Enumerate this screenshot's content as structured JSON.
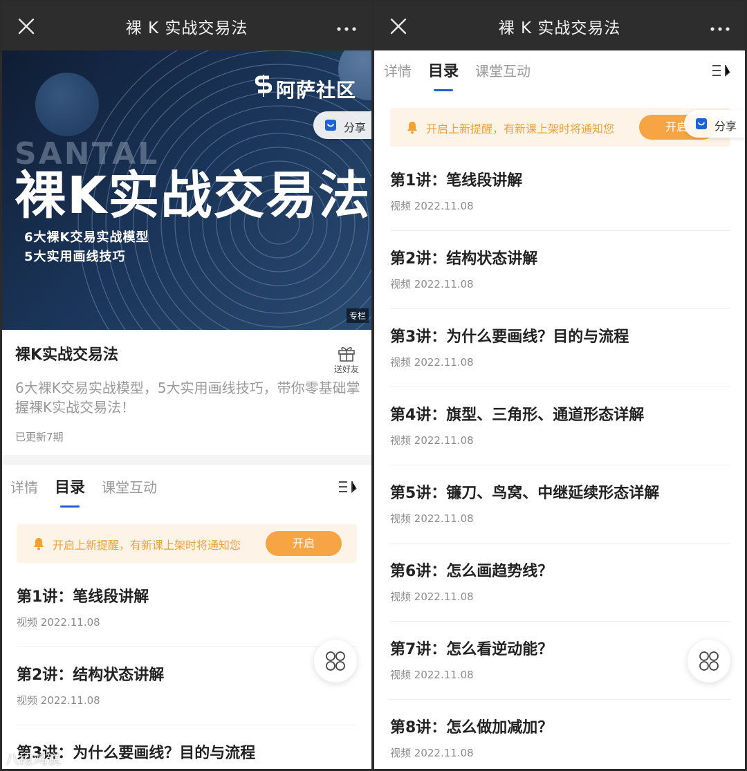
{
  "colors": {
    "accent": "#1b63d6",
    "notice_bg": "#fdf3e6",
    "notice_text": "#f0a23a",
    "on_button": "#f7a544",
    "navbar": "#2d2d2d"
  },
  "navbar": {
    "title": "裸 K 实战交易法",
    "close_icon": "close-icon",
    "more_icon": "more-icon"
  },
  "cover": {
    "brand": "阿萨社区",
    "watermark": "SANTAL",
    "title": "裸K实战交易法",
    "line1": "6大裸K交易实战模型",
    "line2": "5大实用画线技巧",
    "column_tag": "专栏"
  },
  "share": {
    "label": "分享",
    "icon": "share-icon"
  },
  "info": {
    "title": "裸K实战交易法",
    "description": "6大裸K交易实战模型，5大实用画线技巧，带你零基础掌握裸K实战交易法！",
    "gift_label": "送好友",
    "update_count": "已更新7期"
  },
  "tabs": [
    {
      "label": "详情",
      "active": false
    },
    {
      "label": "目录",
      "active": true
    },
    {
      "label": "课堂互动",
      "active": false
    }
  ],
  "notice": {
    "text": "开启上新提醒，有新课上架时将通知您",
    "button": "开启",
    "button_partial": "开启"
  },
  "lessons": [
    {
      "title": "第1讲：笔线段讲解",
      "type": "视频",
      "date": "2022.11.08"
    },
    {
      "title": "第2讲：结构状态讲解",
      "type": "视频",
      "date": "2022.11.08"
    },
    {
      "title": "第3讲：为什么要画线？目的与流程",
      "type": "视频",
      "date": "2022.11.08"
    },
    {
      "title": "第4讲：旗型、三角形、通道形态详解",
      "type": "视频",
      "date": "2022.11.08"
    },
    {
      "title": "第5讲：镰刀、鸟窝、中继延续形态详解",
      "type": "视频",
      "date": "2022.11.08"
    },
    {
      "title": "第6讲：怎么画趋势线？",
      "type": "视频",
      "date": "2022.11.08"
    },
    {
      "title": "第7讲：怎么看逆动能？",
      "type": "视频",
      "date": "2022.11.08"
    },
    {
      "title": "第8讲：怎么做加减加？",
      "type": "视频",
      "date": "2022.11.08"
    }
  ],
  "watermark_bottom": "八段鸡说"
}
